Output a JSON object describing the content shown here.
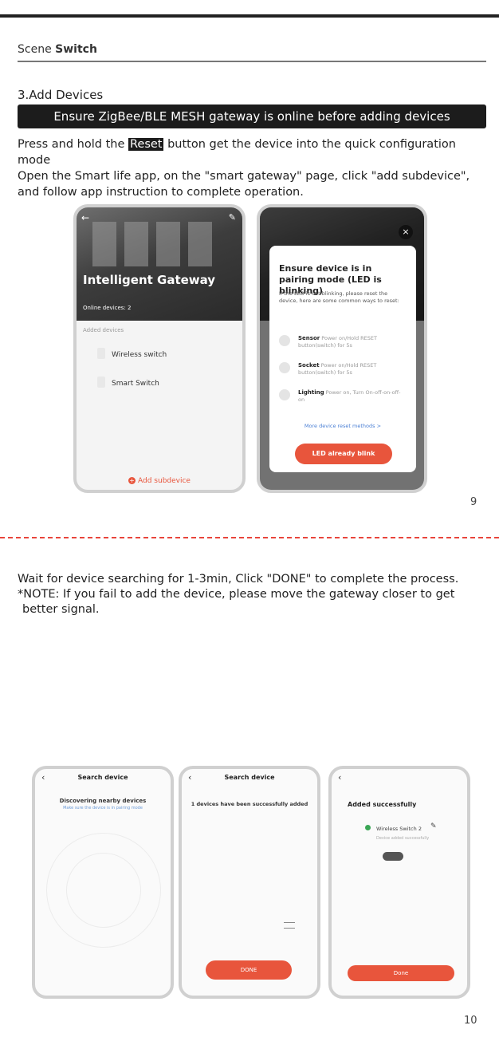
{
  "header": {
    "prefix": "Scene",
    "title": "Switch"
  },
  "section": {
    "title": "3.Add Devices",
    "banner": "Ensure ZigBee/BLE MESH gateway is online before adding devices",
    "line1_pre": "Press and hold the ",
    "line1_highlight": "Reset",
    "line1_post": " button get the device into the quick configuration mode",
    "line2": "Open the Smart life app, on the \"smart gateway\" page, click \"add subdevice\",",
    "line3": "and follow app instruction to complete operation."
  },
  "phone1": {
    "title": "Intelligent Gateway",
    "online": "Online devices: 2",
    "added_label": "Added devices",
    "devices": [
      "Wireless switch",
      "Smart Switch"
    ],
    "add_button": "Add subdevice"
  },
  "phone2": {
    "modal_title": "Ensure device is in pairing mode (LED is blinking)",
    "modal_desc": "If the LED is not blinking, please reset the device, here are some common ways to reset:",
    "methods": [
      {
        "name": "Sensor",
        "desc": "Power on/Hold RESET button(switch) for 5s"
      },
      {
        "name": "Socket",
        "desc": "Power on/Hold RESET button(switch) for 5s"
      },
      {
        "name": "Lighting",
        "desc": "Power on, Turn On-off-on-off-on"
      }
    ],
    "more": "More device reset methods >",
    "button": "LED already blink",
    "close": "×"
  },
  "page_numbers": {
    "first": "9",
    "second": "10"
  },
  "section2": {
    "line1": "Wait for device searching for 1-3min, Click \"DONE\" to complete the process.",
    "line2": "*NOTE: If you fail to add the device, please move the gateway closer to get",
    "line3": "better signal."
  },
  "screen1": {
    "title": "Search device",
    "status": "Discovering nearby devices",
    "hint": "Make sure the device is in pairing mode"
  },
  "screen2": {
    "title": "Search device",
    "status": "1 devices have been successfully added",
    "button": "DONE"
  },
  "screen3": {
    "title": "Added successfully",
    "device": "Wireless Switch 2",
    "device_status": "Device added successfully",
    "button": "Done"
  },
  "colors": {
    "accent": "#e8553c",
    "banner_bg": "#1c1c1c",
    "dash": "#e8453c"
  },
  "icons": [
    "back-arrow-icon",
    "edit-icon",
    "plus-circle-icon",
    "close-icon",
    "sensor-icon",
    "socket-icon",
    "bulb-icon",
    "device-icon"
  ]
}
